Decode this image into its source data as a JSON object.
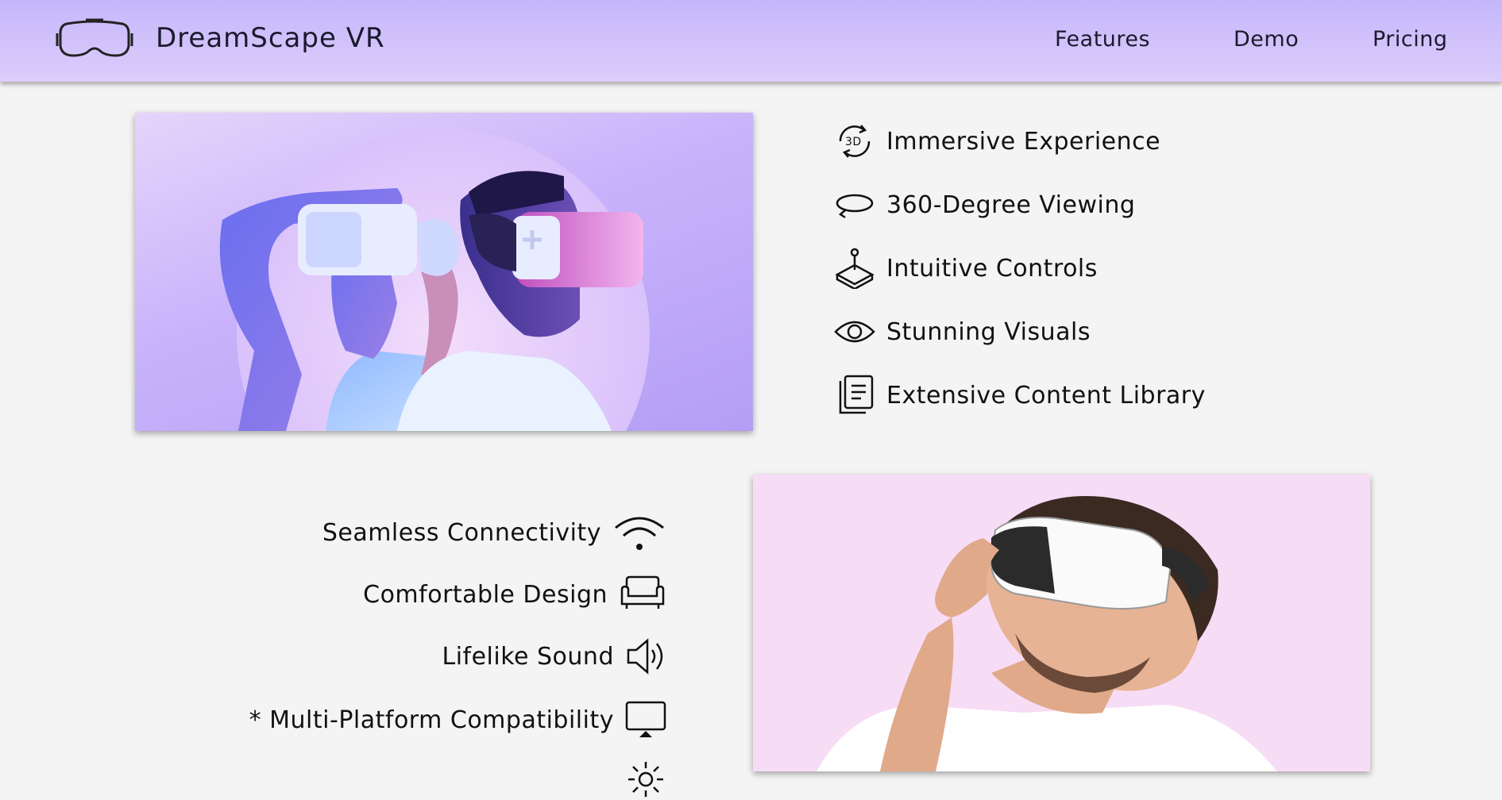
{
  "header": {
    "brand": "DreamScape VR",
    "logo_icon": "vr-headset-icon",
    "nav": [
      {
        "label": "Features"
      },
      {
        "label": "Demo"
      },
      {
        "label": "Pricing"
      }
    ]
  },
  "colors": {
    "header_gradient_top": "#c5b6fb",
    "header_gradient_bottom": "#dccdfb",
    "page_background": "#f4f4f4",
    "hero2_background": "#f7dcf6"
  },
  "features_right": [
    {
      "label": "Immersive Experience",
      "icon": "3d-rotate-icon"
    },
    {
      "label": "360-Degree Viewing",
      "icon": "360-view-icon"
    },
    {
      "label": "Intuitive Controls",
      "icon": "joystick-icon"
    },
    {
      "label": "Stunning Visuals",
      "icon": "eye-icon"
    },
    {
      "label": "Extensive Content Library",
      "icon": "library-icon"
    }
  ],
  "features_left": [
    {
      "label": "Seamless Connectivity",
      "icon": "wifi-icon"
    },
    {
      "label": "Comfortable Design",
      "icon": "sofa-icon"
    },
    {
      "label": "Lifelike Sound",
      "icon": "speaker-icon"
    },
    {
      "label": "* Multi-Platform Compatibility",
      "icon": "monitor-icon"
    },
    {
      "label": "",
      "icon": "gear-icon"
    }
  ],
  "images": [
    {
      "name": "couple-vr-photo"
    },
    {
      "name": "man-vr-photo"
    }
  ]
}
